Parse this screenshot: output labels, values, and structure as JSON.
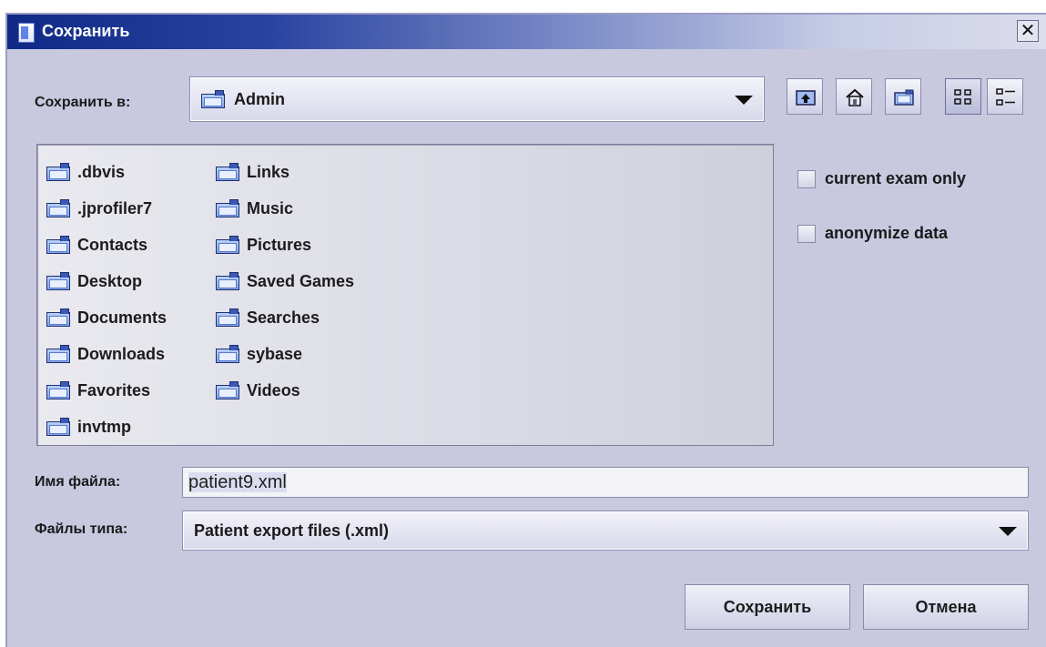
{
  "window": {
    "title": "Сохранить",
    "close_glyph": "✕"
  },
  "save_in": {
    "label": "Сохранить в:",
    "value": "Admin"
  },
  "toolbar": {
    "icons": [
      "up-folder-icon",
      "home-icon",
      "new-folder-icon",
      "list-view-icon",
      "details-view-icon"
    ]
  },
  "files": {
    "column1": [
      ".dbvis",
      ".jprofiler7",
      "Contacts",
      "Desktop",
      "Documents",
      "Downloads",
      "Favorites",
      "invtmp"
    ],
    "column2": [
      "Links",
      "Music",
      "Pictures",
      "Saved Games",
      "Searches",
      "sybase",
      "Videos"
    ]
  },
  "options": {
    "current_exam_only": "current exam only",
    "anonymize_data": "anonymize data"
  },
  "file_name": {
    "label": "Имя файла:",
    "value": "patient9.xml"
  },
  "file_type": {
    "label": "Файлы типа:",
    "value": "Patient export files (.xml)"
  },
  "buttons": {
    "save": "Сохранить",
    "cancel": "Отмена"
  }
}
